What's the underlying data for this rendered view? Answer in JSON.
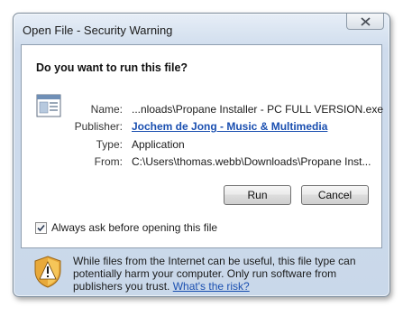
{
  "window": {
    "title": "Open File - Security Warning",
    "close_icon": "close-icon"
  },
  "dialog": {
    "question": "Do you want to run this file?",
    "fields": {
      "name_label": "Name:",
      "name_value": "...nloads\\Propane Installer - PC FULL VERSION.exe",
      "publisher_label": "Publisher:",
      "publisher_value": "Jochem de Jong - Music & Multimedia",
      "type_label": "Type:",
      "type_value": "Application",
      "from_label": "From:",
      "from_value": "C:\\Users\\thomas.webb\\Downloads\\Propane Inst..."
    },
    "buttons": {
      "run_label": "Run",
      "cancel_label": "Cancel"
    },
    "checkbox": {
      "label": "Always ask before opening this file",
      "checked": true
    }
  },
  "warning": {
    "text": "While files from the Internet can be useful, this file type can potentially harm your computer. Only run software from publishers you trust.",
    "link": "What's the risk?",
    "icon": "shield-warning-icon"
  },
  "colors": {
    "link": "#1a4fb0",
    "frame": "#c9d8ea"
  }
}
